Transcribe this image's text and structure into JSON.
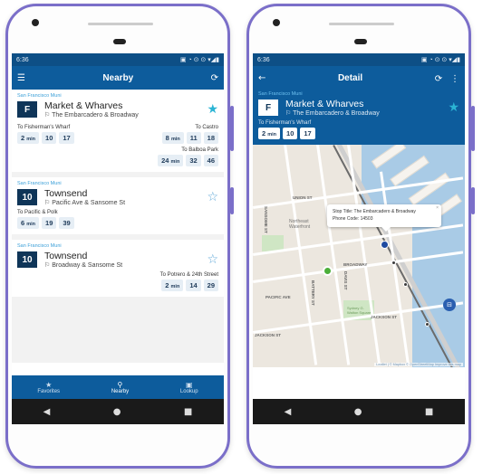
{
  "status": {
    "time": "6:36"
  },
  "nearby": {
    "title": "Nearby",
    "cards": [
      {
        "agency": "San Francisco Muni",
        "route": "F",
        "name": "Market & Wharves",
        "stop": "The Embarcadero & Broadway",
        "favorite": true,
        "dirs": [
          {
            "label": "To Fisherman's Wharf",
            "times": [
              "2",
              "10",
              "17"
            ]
          },
          {
            "label": "To Castro",
            "times": [
              "8",
              "11",
              "18"
            ]
          },
          {
            "label": "To Balboa Park",
            "times": [
              "24",
              "32",
              "46"
            ]
          }
        ]
      },
      {
        "agency": "San Francisco Muni",
        "route": "10",
        "name": "Townsend",
        "stop": "Pacific Ave & Sansome St",
        "favorite": false,
        "dirs": [
          {
            "label": "To Pacific & Polk",
            "times": [
              "6",
              "19",
              "39"
            ]
          }
        ]
      },
      {
        "agency": "San Francisco Muni",
        "route": "10",
        "name": "Townsend",
        "stop": "Broadway & Sansome St",
        "favorite": false,
        "dirs": [
          {
            "label": "To Potrero & 24th Street",
            "times": [
              "2",
              "14",
              "29"
            ]
          }
        ]
      }
    ],
    "min_unit": "min",
    "nav": {
      "favorites": "Favorites",
      "nearby": "Nearby",
      "lookup": "Lookup"
    }
  },
  "detail": {
    "title": "Detail",
    "agency": "San Francisco Muni",
    "route": "F",
    "name": "Market & Wharves",
    "stop": "The Embarcadero & Broadway",
    "dir_label": "To Fisherman's Wharf",
    "times": [
      "2",
      "10",
      "17"
    ],
    "popup_title": "Stop Title: The Embarcadero & Broadway",
    "popup_phone": "Phone Code: 14503",
    "attribution": "Leaflet | © Mapbox © OpenStreetMap Improve this map",
    "streets": [
      "UNION ST",
      "SANSOME ST",
      "BATTERY ST",
      "BROADWAY",
      "PACIFIC AVE",
      "JACKSON ST",
      "JACKSON ST",
      "DAVIS ST"
    ],
    "places": [
      "Northeast Waterfront",
      "Sydney G. Walton Square"
    ]
  },
  "colors": {
    "primary": "#0d5c9c",
    "badge": "#0f3558",
    "star": "#2bb4d4",
    "frame": "#7b6fc9"
  }
}
